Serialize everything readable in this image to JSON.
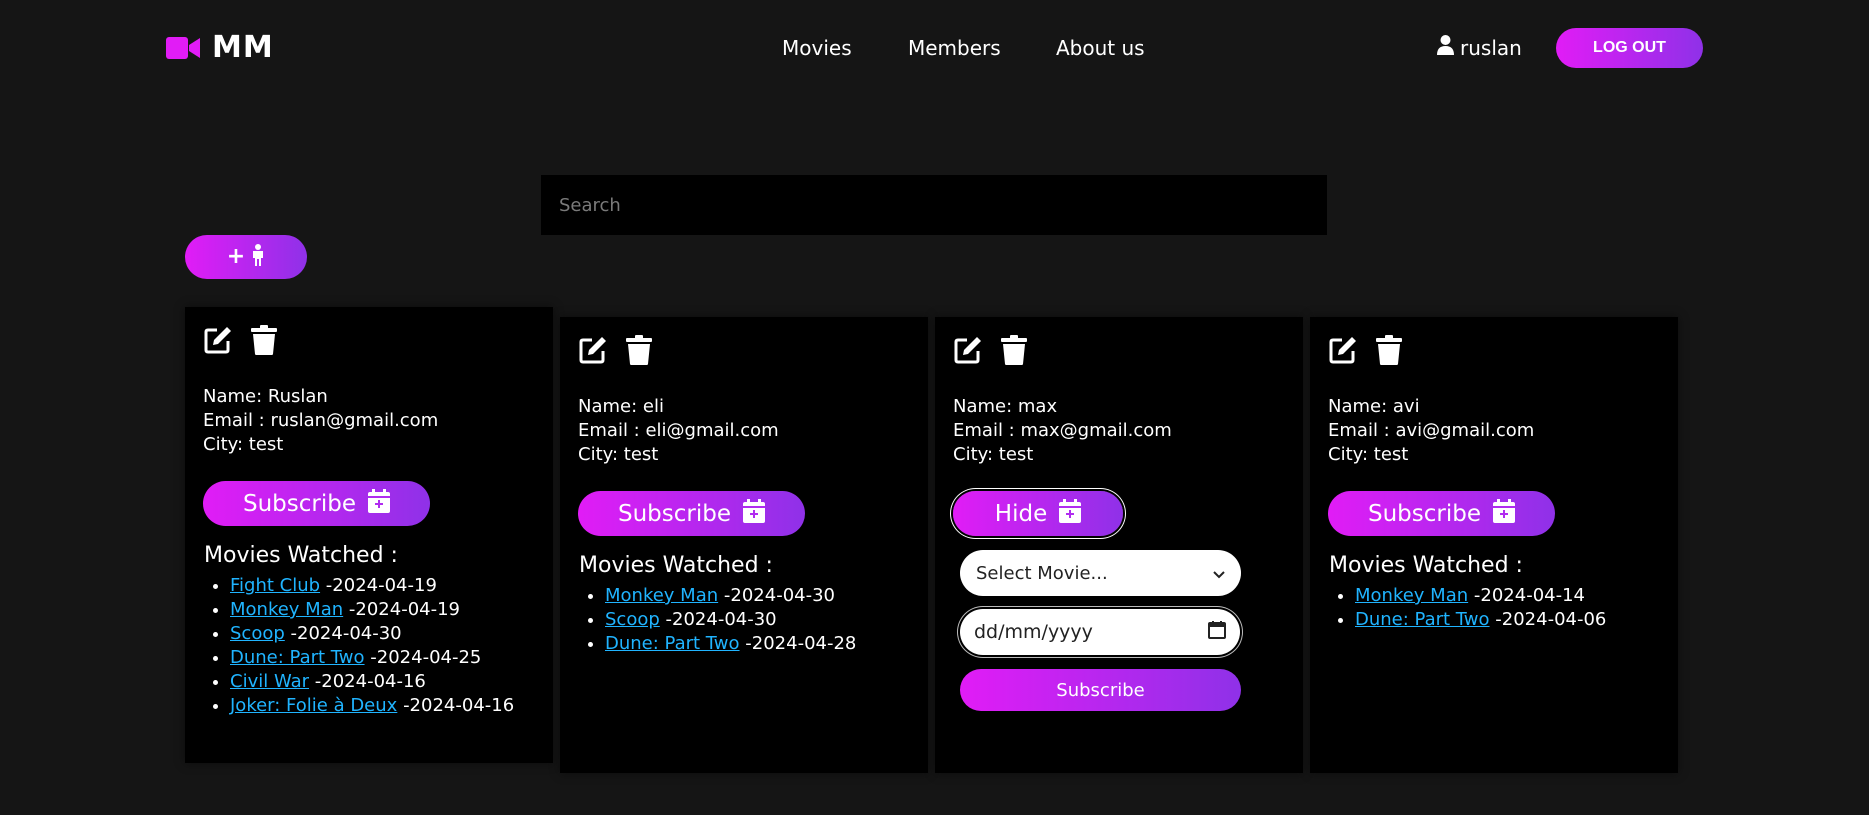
{
  "header": {
    "logo_text": "MM",
    "nav": [
      "Movies",
      "Members",
      "About us"
    ],
    "username": "ruslan",
    "logout_label": "LOG OUT"
  },
  "search": {
    "placeholder": "Search"
  },
  "colors": {
    "accent_start": "#e11cf6",
    "accent_end": "#8f31e8",
    "link": "#20b4ff",
    "background": "#151515",
    "card": "#000000"
  },
  "icons": {
    "logo": "video-camera-icon",
    "user": "user-icon",
    "edit": "edit-icon",
    "delete": "trash-icon",
    "calendar": "calendar-plus-icon",
    "add_member": "person-plus-icon"
  },
  "members": [
    {
      "name": "Name: Ruslan",
      "email": "Email : ruslan@gmail.com",
      "city": "City: test",
      "button": "Subscribe",
      "movies_title": "Movies Watched :",
      "movies": [
        {
          "title": "Fight Club",
          "date": "-2024-04-19"
        },
        {
          "title": "Monkey Man",
          "date": "-2024-04-19"
        },
        {
          "title": "Scoop",
          "date": "-2024-04-30"
        },
        {
          "title": "Dune: Part Two",
          "date": "-2024-04-25"
        },
        {
          "title": "Civil War",
          "date": "-2024-04-16"
        },
        {
          "title": "Joker: Folie à Deux",
          "date": "-2024-04-16"
        }
      ]
    },
    {
      "name": "Name: eli",
      "email": "Email : eli@gmail.com",
      "city": "City: test",
      "button": "Subscribe",
      "movies_title": "Movies Watched :",
      "movies": [
        {
          "title": "Monkey Man",
          "date": "-2024-04-30"
        },
        {
          "title": "Scoop",
          "date": "-2024-04-30"
        },
        {
          "title": "Dune: Part Two",
          "date": "-2024-04-28"
        }
      ]
    },
    {
      "name": "Name: max",
      "email": "Email : max@gmail.com",
      "city": "City: test",
      "button": "Hide",
      "subscribe_form": {
        "select_value": "Select Movie...",
        "date_placeholder": "dd/mm/yyyy",
        "submit_label": "Subscribe"
      }
    },
    {
      "name": "Name: avi",
      "email": "Email : avi@gmail.com",
      "city": "City: test",
      "button": "Subscribe",
      "movies_title": "Movies Watched :",
      "movies": [
        {
          "title": "Monkey Man",
          "date": "-2024-04-14"
        },
        {
          "title": "Dune: Part Two",
          "date": "-2024-04-06"
        }
      ]
    }
  ]
}
